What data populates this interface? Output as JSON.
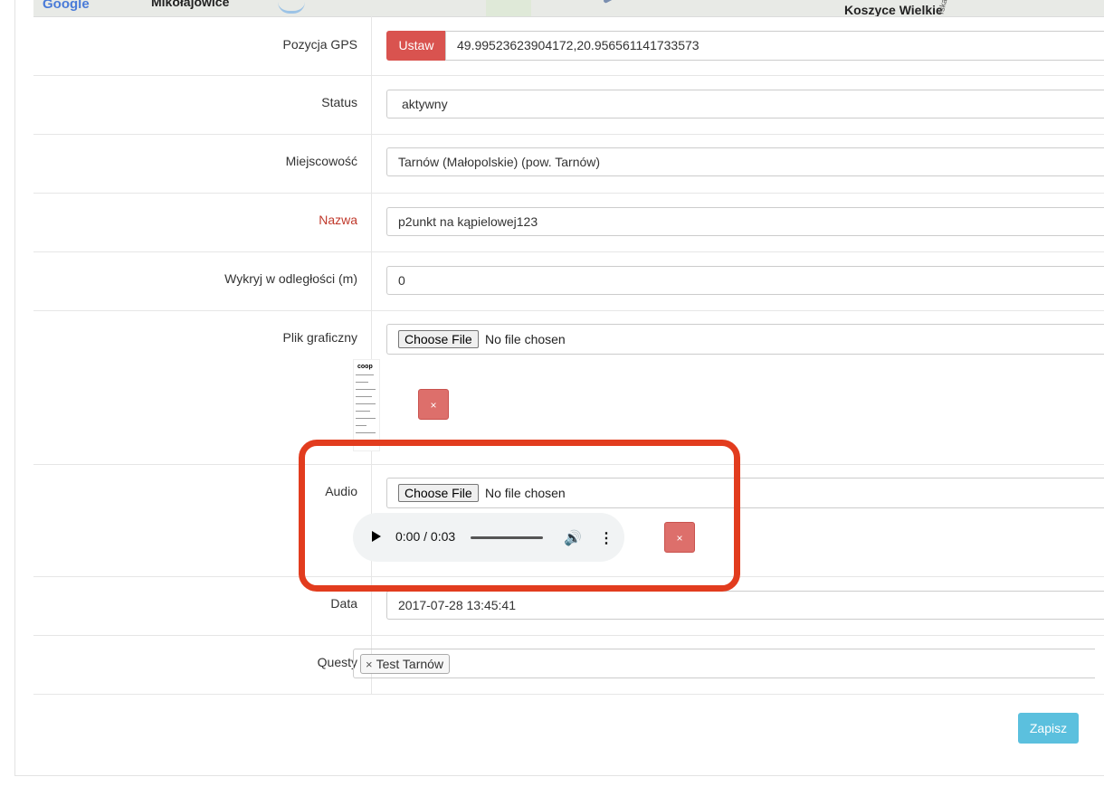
{
  "map": {
    "google_label": "Google",
    "place_1": "Mikołajowice",
    "place_2": "Koszyce Wielkie",
    "street_label": "rska"
  },
  "form": {
    "gps": {
      "label": "Pozycja GPS",
      "button": "Ustaw",
      "value": "49.99523623904172,20.956561141733573"
    },
    "status": {
      "label": "Status",
      "value": "aktywny"
    },
    "locality": {
      "label": "Miejscowość",
      "value": "Tarnów (Małopolskie) (pow. Tarnów)"
    },
    "name": {
      "label": "Nazwa",
      "value": "p2unkt na kąpielowej123"
    },
    "detect": {
      "label": "Wykryj w odległości (m)",
      "value": "0"
    },
    "image": {
      "label": "Plik graficzny",
      "choose": "Choose File",
      "none": "No file chosen",
      "thumb_logo": "coop",
      "delete": "×"
    },
    "audio": {
      "label": "Audio",
      "choose": "Choose File",
      "none": "No file chosen",
      "time": "0:00 / 0:03",
      "delete": "×"
    },
    "date": {
      "label": "Data",
      "value": "2017-07-28 13:45:41"
    },
    "quests": {
      "label": "Questy",
      "tags": [
        {
          "remove": "×",
          "text": "Test Tarnów"
        }
      ]
    },
    "save": "Zapisz"
  },
  "colors": {
    "danger": "#d9534f",
    "info": "#5bc0de",
    "highlight": "#e23c1e"
  }
}
